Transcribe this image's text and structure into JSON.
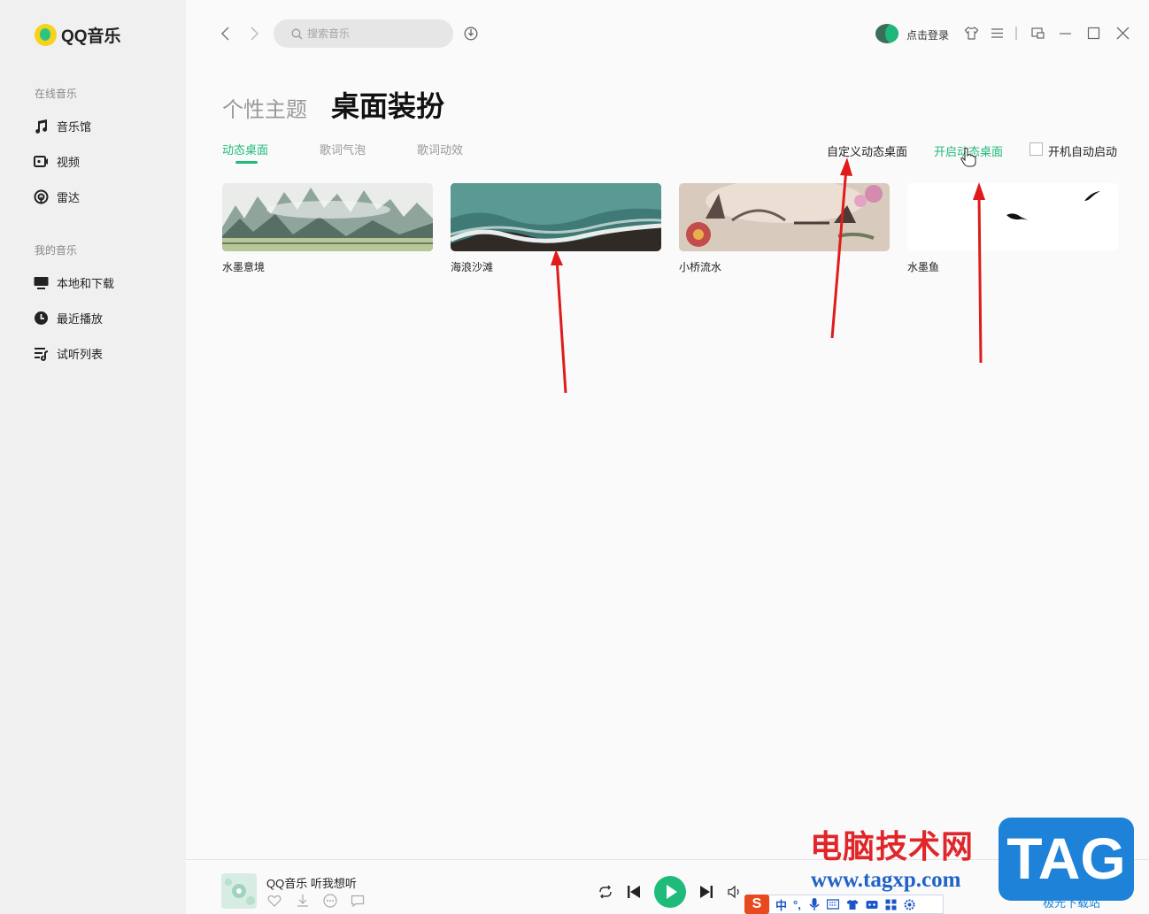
{
  "app": {
    "logo_text": "QQ音乐"
  },
  "sidebar": {
    "online_title": "在线音乐",
    "online_items": [
      {
        "label": "音乐馆",
        "icon": "music-note-icon"
      },
      {
        "label": "视频",
        "icon": "video-icon"
      },
      {
        "label": "雷达",
        "icon": "radar-icon"
      }
    ],
    "mine_title": "我的音乐",
    "mine_items": [
      {
        "label": "本地和下载",
        "icon": "monitor-icon"
      },
      {
        "label": "最近播放",
        "icon": "clock-icon"
      },
      {
        "label": "试听列表",
        "icon": "playlist-icon"
      }
    ]
  },
  "topbar": {
    "search_placeholder": "搜索音乐",
    "login_label": "点击登录"
  },
  "page": {
    "tab_inactive": "个性主题",
    "tab_active": "桌面装扮"
  },
  "subtabs": [
    "动态桌面",
    "歌词气泡",
    "歌词动效"
  ],
  "actions": {
    "custom": "自定义动态桌面",
    "enable": "开启动态桌面",
    "autostart": "开机自动启动"
  },
  "cards": [
    {
      "label": "水墨意境"
    },
    {
      "label": "海浪沙滩"
    },
    {
      "label": "小桥流水"
    },
    {
      "label": "水墨鱼"
    }
  ],
  "player": {
    "song": "QQ音乐 听我想听"
  },
  "ime": {
    "items": [
      "中",
      "°,"
    ]
  },
  "watermark": {
    "title": "电脑技术网",
    "url": "www.tagxp.com",
    "badge": "TAG",
    "sub": "极光下载站"
  },
  "colors": {
    "accent": "#1fbb7a",
    "annotation": "#e01b1b"
  }
}
